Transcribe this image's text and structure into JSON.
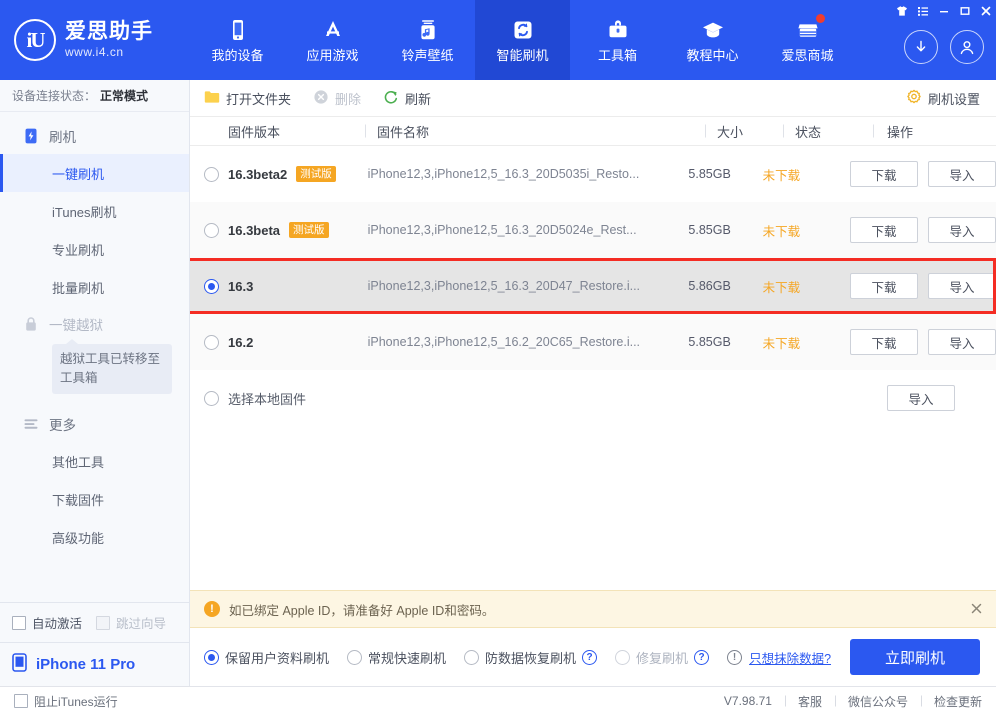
{
  "header": {
    "brand_mark": "iU",
    "brand_name": "爱思助手",
    "brand_url": "www.i4.cn",
    "nav": [
      {
        "label": "我的设备",
        "icon": "phone-icon",
        "active": false
      },
      {
        "label": "应用游戏",
        "icon": "appstore-icon",
        "active": false
      },
      {
        "label": "铃声壁纸",
        "icon": "music-icon",
        "active": false
      },
      {
        "label": "智能刷机",
        "icon": "refresh-icon",
        "active": true
      },
      {
        "label": "工具箱",
        "icon": "toolbox-icon",
        "active": false
      },
      {
        "label": "教程中心",
        "icon": "graduation-cap-icon",
        "active": false
      },
      {
        "label": "爱思商城",
        "icon": "shop-icon",
        "active": false,
        "badge": true
      }
    ],
    "window_controls": [
      "shirt-icon",
      "list-icon",
      "minimize-icon",
      "maximize-icon",
      "close-icon"
    ],
    "right_actions": [
      "download-circle-icon",
      "account-circle-icon"
    ]
  },
  "sidebar": {
    "connection_label": "设备连接状态：",
    "connection_value": "正常模式",
    "group_flash": {
      "label": "刷机",
      "icon": "flash-device-icon"
    },
    "flash_items": [
      {
        "label": "一键刷机",
        "active": true
      },
      {
        "label": "iTunes刷机",
        "active": false
      },
      {
        "label": "专业刷机",
        "active": false
      },
      {
        "label": "批量刷机",
        "active": false
      }
    ],
    "group_jailbreak": {
      "label": "一键越狱",
      "icon": "lock-icon"
    },
    "jailbreak_tooltip": "越狱工具已转移至工具箱",
    "group_more": {
      "label": "更多",
      "icon": "menu-lines-icon"
    },
    "more_items": [
      {
        "label": "其他工具"
      },
      {
        "label": "下载固件"
      },
      {
        "label": "高级功能"
      }
    ],
    "checkboxes": [
      {
        "label": "自动激活",
        "checked": false,
        "disabled": false
      },
      {
        "label": "跳过向导",
        "checked": false,
        "disabled": true
      }
    ],
    "device": {
      "label": "iPhone 11 Pro",
      "icon": "phone-icon"
    }
  },
  "toolbar": {
    "open_folder": "打开文件夹",
    "delete": "删除",
    "refresh": "刷新",
    "settings": "刷机设置"
  },
  "table": {
    "columns": [
      "固件版本",
      "固件名称",
      "大小",
      "状态",
      "操作"
    ],
    "rows": [
      {
        "version": "16.3beta2",
        "tag": "测试版",
        "name": "iPhone12,3,iPhone12,5_16.3_20D5035i_Resto...",
        "size": "5.85GB",
        "state": "未下载",
        "download": "下载",
        "import": "导入",
        "selected": false
      },
      {
        "version": "16.3beta",
        "tag": "测试版",
        "name": "iPhone12,3,iPhone12,5_16.3_20D5024e_Rest...",
        "size": "5.85GB",
        "state": "未下载",
        "download": "下载",
        "import": "导入",
        "selected": false
      },
      {
        "version": "16.3",
        "tag": "",
        "name": "iPhone12,3,iPhone12,5_16.3_20D47_Restore.i...",
        "size": "5.86GB",
        "state": "未下载",
        "download": "下载",
        "import": "导入",
        "selected": true
      },
      {
        "version": "16.2",
        "tag": "",
        "name": "iPhone12,3,iPhone12,5_16.2_20C65_Restore.i...",
        "size": "5.85GB",
        "state": "未下载",
        "download": "下载",
        "import": "导入",
        "selected": false
      }
    ],
    "local_row": {
      "label": "选择本地固件",
      "import": "导入",
      "selected": false
    }
  },
  "notice": {
    "text": "如已绑定 Apple ID，请准备好 Apple ID和密码。",
    "icon": "warning-icon",
    "close_icon": "close-icon"
  },
  "options": {
    "items": [
      {
        "label": "保留用户资料刷机",
        "checked": true,
        "disabled": false,
        "help": false
      },
      {
        "label": "常规快速刷机",
        "checked": false,
        "disabled": false,
        "help": false
      },
      {
        "label": "防数据恢复刷机",
        "checked": false,
        "disabled": false,
        "help": true
      },
      {
        "label": "修复刷机",
        "checked": false,
        "disabled": true,
        "help": true
      }
    ],
    "erase_link": "只想抹除数据?",
    "erase_icon": "info-icon",
    "flash_button": "立即刷机"
  },
  "statusbar": {
    "itunes_block": "阻止iTunes运行",
    "version": "V7.98.71",
    "links": [
      "客服",
      "微信公众号",
      "检查更新"
    ]
  },
  "colors": {
    "brand_blue": "#2b58f0",
    "nav_active": "#2148d4",
    "highlight_red": "#f42c23",
    "warning_orange": "#f5a623",
    "notice_bg": "#fdf6e3"
  }
}
